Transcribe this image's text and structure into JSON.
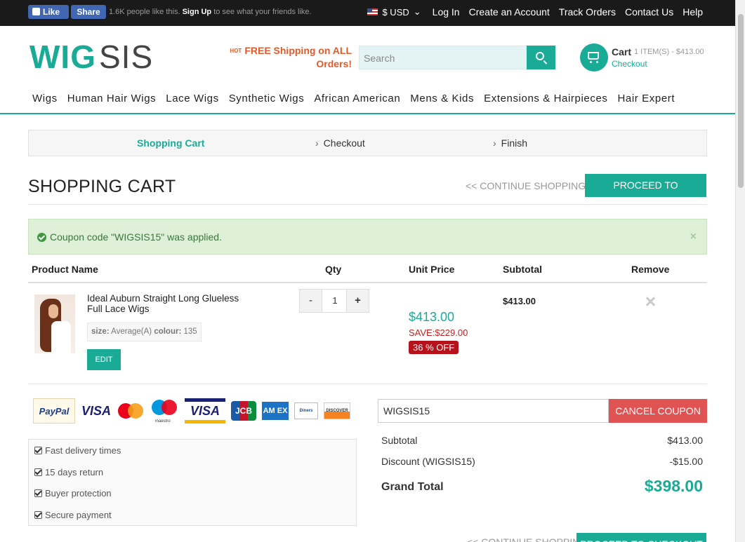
{
  "topbar": {
    "fb_like": "Like",
    "fb_share": "Share",
    "fb_count_text": "1.6K people like this.",
    "fb_signup": "Sign Up",
    "fb_suffix": "to see what your friends like.",
    "currency": "$ USD",
    "links": [
      "Log In",
      "Create an Account",
      "Track Orders",
      "Contact Us",
      "Help"
    ]
  },
  "header": {
    "logo_part1": "WIG",
    "logo_part2": "SIS",
    "promo_hot": "HOT",
    "promo_text": "FREE Shipping on ALL Orders!",
    "search_placeholder": "Search",
    "cart_label": "Cart",
    "cart_items": "1 ITEM(S) - $413.00",
    "cart_checkout": "Checkout"
  },
  "nav": [
    "Wigs",
    "Human Hair Wigs",
    "Lace Wigs",
    "Synthetic Wigs",
    "African American",
    "Mens & Kids",
    "Extensions & Hairpieces",
    "Hair Expert"
  ],
  "steps": {
    "cart": "Shopping Cart",
    "checkout": "Checkout",
    "finish": "Finish"
  },
  "page": {
    "title": "SHOPPING CART",
    "continue_label": "<< CONTINUE SHOPPING",
    "checkout_label": "PROCEED TO CHECKOUT",
    "alert": "Coupon code \"WIGSIS15\" was applied.",
    "alert_close": "×"
  },
  "table": {
    "headers": {
      "product": "Product Name",
      "qty": "Qty",
      "unit_price": "Unit Price",
      "subtotal": "Subtotal",
      "remove": "Remove"
    },
    "item": {
      "name": "Ideal Auburn Straight Long Glueless Full Lace Wigs",
      "size_label": "size:",
      "size_value": "Average(A)",
      "colour_label": "colour:",
      "colour_value": "135",
      "edit": "EDIT",
      "qty_minus": "-",
      "qty": "1",
      "qty_plus": "+",
      "unit_price": "$413.00",
      "save": "SAVE:$229.00",
      "off": "36 % OFF",
      "subtotal": "$413.00"
    }
  },
  "payment_logos": [
    "PayPal",
    "VISA",
    "mastercard",
    "maestro",
    "VISA Electron",
    "JCB",
    "AMEX",
    "Diners Club",
    "DISCOVER"
  ],
  "features": [
    "Fast delivery times",
    "15 days return",
    "Buyer protection",
    "Secure payment"
  ],
  "coupon": {
    "value": "WIGSIS15",
    "cancel_label": "CANCEL COUPON"
  },
  "totals": {
    "subtotal_label": "Subtotal",
    "subtotal": "$413.00",
    "discount_label": "Discount (WIGSIS15)",
    "discount": "-$15.00",
    "grand_label": "Grand Total",
    "grand": "$398.00"
  },
  "colors": {
    "accent": "#1aab96",
    "danger": "#e05353",
    "sale_red": "#b5121b"
  }
}
